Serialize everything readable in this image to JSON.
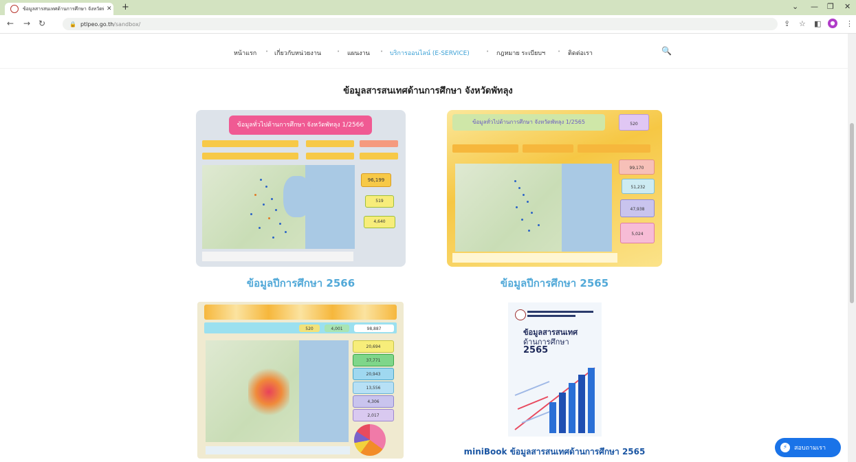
{
  "browser": {
    "tab_title": "ข้อมูลสารสนเทศด้านการศึกษา จังหวัดพัทลุง",
    "url_host": "ptlpeo.go.th",
    "url_path": "/sandbox/"
  },
  "nav": {
    "items": [
      "หน้าแรก",
      "เกี่ยวกับหน่วยงาน",
      "แผนงาน",
      "บริการออนไลน์ (E-SERVICE)",
      "กฎหมาย ระเบียบฯ",
      "ติดต่อเรา"
    ]
  },
  "page": {
    "heading": "ข้อมูลสารสนเทศด้านการศึกษา จังหวัดพัทลุง"
  },
  "cards": [
    {
      "caption": "ข้อมูลปีการศึกษา 2566",
      "banner": "ข้อมูลทั่วไปด้านการศึกษา จังหวัดพัทลุง 1/2566",
      "kpis": [
        "96,199",
        "519",
        "4,640"
      ]
    },
    {
      "caption": "ข้อมูลปีการศึกษา 2565",
      "banner": "ข้อมูลทั่วไปด้านการศึกษา จังหวัดพัทลุง 1/2565",
      "top": "520",
      "kpis": [
        "99,170",
        "51,232",
        "47,938",
        "5,024"
      ]
    },
    {
      "kpis_top": [
        "520",
        "4,001",
        "98,887"
      ],
      "kpis": [
        "20,694",
        "37,771",
        "20,943",
        "13,556",
        "4,306",
        "2,017"
      ]
    },
    {
      "caption": "miniBook ข้อมูลสารสนเทศด้านการศึกษา 2565",
      "cover_title_1": "ข้อมูลสารสนเทศ",
      "cover_title_2": "ด้านการศึกษา",
      "cover_year": "2565"
    }
  ],
  "chat": {
    "label": "สอบถามเรา"
  }
}
